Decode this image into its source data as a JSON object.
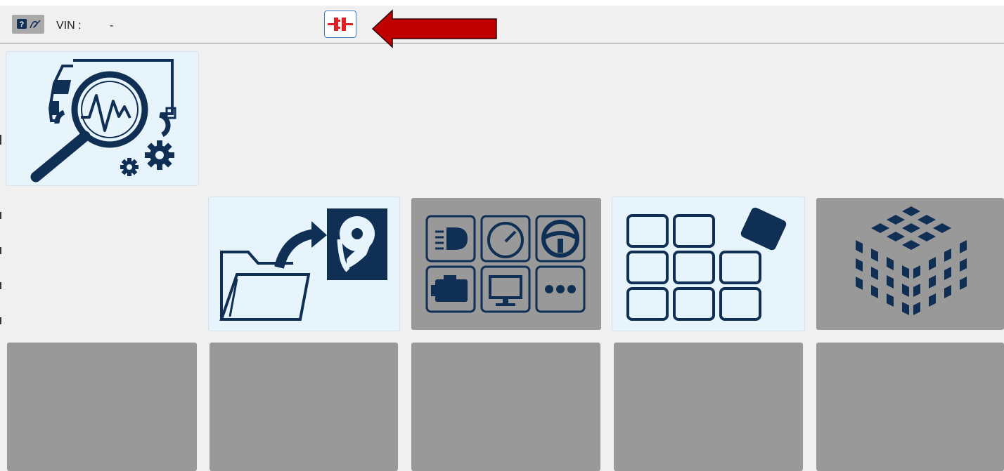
{
  "toolbar": {
    "vin_label": "VIN :",
    "vin_value": "-",
    "logo_icon": "help-manual-icon",
    "connect_button_icon": "disconnect-plug-icon",
    "connect_button_color": "#e02020",
    "annotation_arrow_color": "#c00000"
  },
  "tiles": {
    "diagnostics": {
      "icon": "truck-diagnostics-magnifier-icon",
      "state": "enabled"
    },
    "file_transfer": {
      "icon": "folder-to-harddisk-icon",
      "state": "enabled"
    },
    "vehicle_functions": {
      "icon": "vehicle-functions-grid-icon",
      "state": "disabled"
    },
    "module_layout": {
      "icon": "tile-grid-icon",
      "state": "enabled"
    },
    "cube": {
      "icon": "cube-dots-icon",
      "state": "disabled"
    },
    "empty_count": 5
  },
  "colors": {
    "icon_navy": "#0f2f55",
    "tile_light": "#e8f4fb",
    "tile_disabled": "#999999",
    "background": "#f0f0f0"
  }
}
